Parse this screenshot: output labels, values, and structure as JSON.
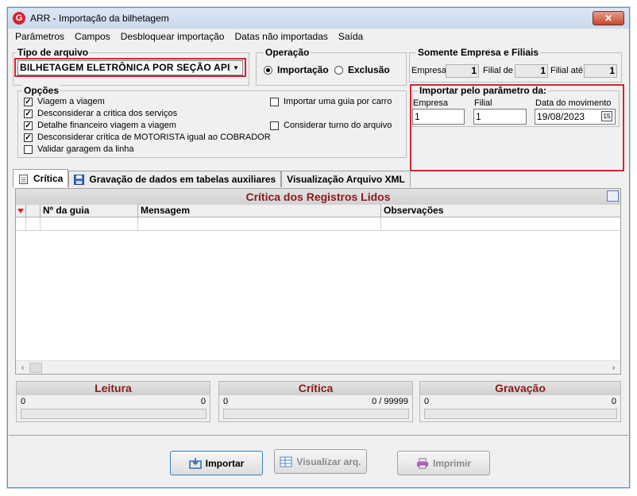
{
  "window": {
    "title": "ARR - Importação da bilhetagem",
    "logo_letter": "G",
    "close_glyph": "✕"
  },
  "menu": [
    "Parâmetros",
    "Campos",
    "Desbloquear importação",
    "Datas não importadas",
    "Saída"
  ],
  "tipo_arquivo": {
    "legend": "Tipo de arquivo",
    "selected": "BILHETAGEM ELETRÔNICA POR SEÇÃO API"
  },
  "operacao": {
    "legend": "Operação",
    "options": [
      {
        "label": "Importação",
        "selected": true
      },
      {
        "label": "Exclusão",
        "selected": false
      }
    ]
  },
  "somente": {
    "legend": "Somente Empresa e Filiais",
    "empresa_label": "Empresa",
    "empresa_value": "1",
    "filial_de_label": "Filial de",
    "filial_de_value": "1",
    "filial_ate_label": "Filial até",
    "filial_ate_value": "1"
  },
  "opcoes": {
    "legend": "Opções",
    "left": [
      {
        "label": "Viagem a viagem",
        "checked": true
      },
      {
        "label": "Desconsiderar a critica dos serviços",
        "checked": true
      },
      {
        "label": "Detalhe financeiro viagem a viagem",
        "checked": true
      },
      {
        "label": "Desconsiderar crítica de MOTORISTA igual ao COBRADOR",
        "checked": true
      },
      {
        "label": "Validar garagem da linha",
        "checked": false
      }
    ],
    "right": [
      {
        "label": "Importar uma guia por carro",
        "checked": false
      },
      {
        "label": "Considerar turno do arquivo",
        "checked": false
      }
    ]
  },
  "importar": {
    "legend": "Importar pelo parâmetro da:",
    "empresa_label": "Empresa",
    "empresa_value": "1",
    "filial_label": "Filial",
    "filial_value": "1",
    "data_label": "Data do movimento",
    "data_value": "19/08/2023",
    "calendar_glyph": "15"
  },
  "tabs": [
    {
      "label": "Crítica",
      "icon": "notepad-icon",
      "active": true
    },
    {
      "label": "Gravação de dados em tabelas auxiliares",
      "icon": "floppy-disk-icon",
      "active": false
    },
    {
      "label": "Visualização Arquivo XML",
      "icon": "",
      "active": false
    }
  ],
  "critica_panel": {
    "title": "Crítica dos Registros Lidos",
    "columns": [
      "",
      "",
      "Nº da guia",
      "Mensagem",
      "Observações"
    ]
  },
  "stats": [
    {
      "title": "Leitura",
      "left": "0",
      "right": "0"
    },
    {
      "title": "Crítica",
      "left": "0",
      "right": "0 / 99999"
    },
    {
      "title": "Gravação",
      "left": "0",
      "right": "0"
    }
  ],
  "buttons": {
    "importar": "Importar",
    "visualizar": "Visualizar arq.",
    "imprimir": "Imprimir"
  },
  "colors": {
    "highlight": "#d9232e",
    "section_title": "#8b1a1a",
    "accent": "#3c7fb1"
  }
}
